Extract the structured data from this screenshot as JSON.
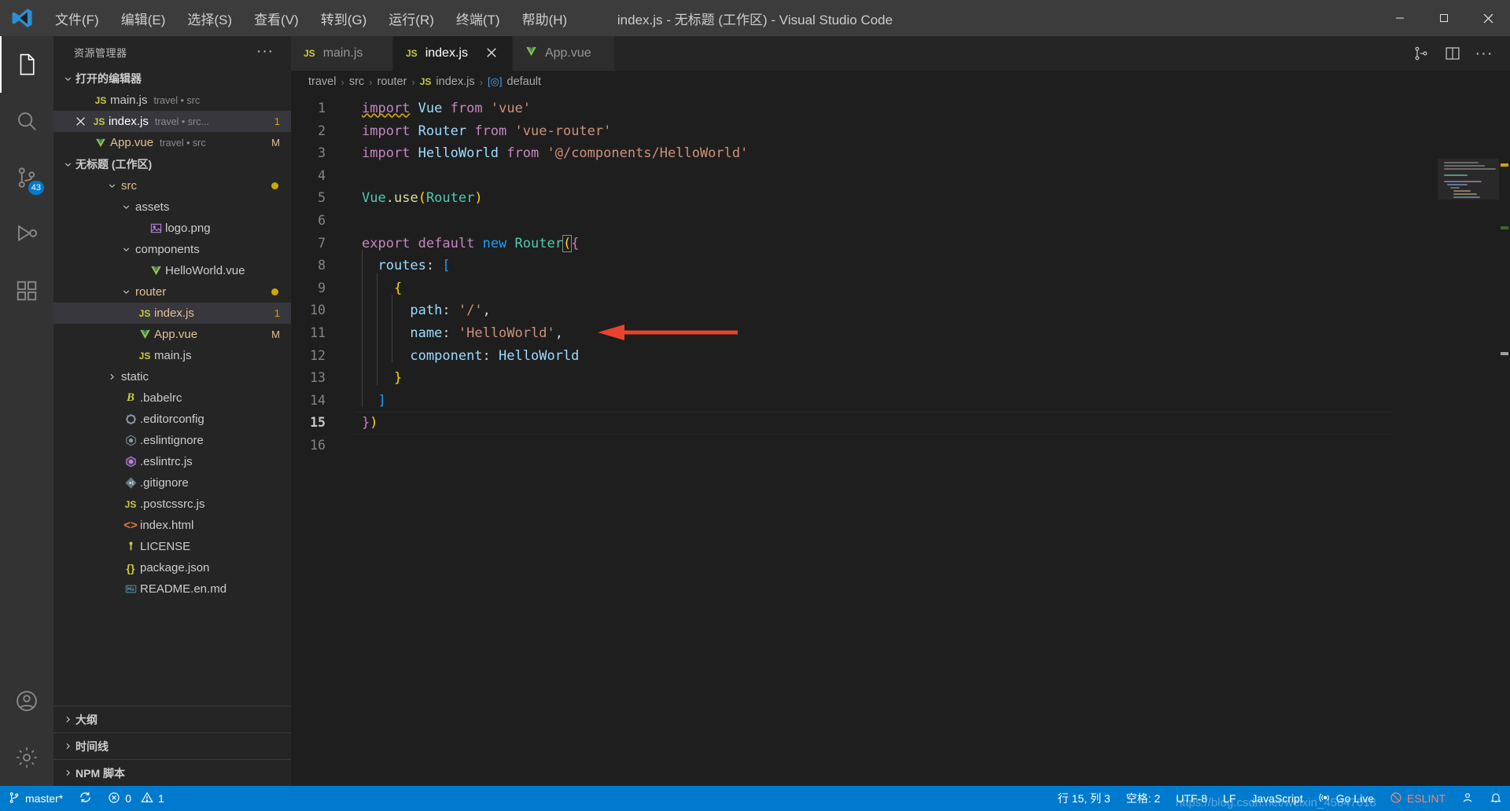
{
  "window": {
    "title": "index.js - 无标题 (工作区) - Visual Studio Code",
    "minimize": "−",
    "maximize": "□",
    "close": "✕"
  },
  "menu": [
    {
      "label": "文件(F)"
    },
    {
      "label": "编辑(E)"
    },
    {
      "label": "选择(S)"
    },
    {
      "label": "查看(V)"
    },
    {
      "label": "转到(G)"
    },
    {
      "label": "运行(R)"
    },
    {
      "label": "终端(T)"
    },
    {
      "label": "帮助(H)"
    }
  ],
  "activitybar": [
    {
      "name": "explorer",
      "icon": "files-icon",
      "active": true,
      "badge": ""
    },
    {
      "name": "search",
      "icon": "search-icon",
      "active": false,
      "badge": ""
    },
    {
      "name": "source-control",
      "icon": "source-control-icon",
      "active": false,
      "badge": "43"
    },
    {
      "name": "run-debug",
      "icon": "run-debug-icon",
      "active": false,
      "badge": ""
    },
    {
      "name": "extensions",
      "icon": "extensions-icon",
      "active": false,
      "badge": ""
    },
    {
      "name": "accounts",
      "icon": "account-icon",
      "active": false,
      "badge": ""
    },
    {
      "name": "settings",
      "icon": "gear-icon",
      "active": false,
      "badge": ""
    }
  ],
  "sidebar": {
    "header": "资源管理器",
    "more": "···",
    "open_editors": {
      "title": "打开的编辑器",
      "items": [
        {
          "name": "main.js",
          "desc": "travel • src",
          "icon": "js-icon",
          "badge": "",
          "selected": false,
          "close": false,
          "color": "#cccccc"
        },
        {
          "name": "index.js",
          "desc": "travel • src...",
          "icon": "js-icon",
          "badge": "1",
          "selected": true,
          "close": true,
          "color": "#e2c08d"
        },
        {
          "name": "App.vue",
          "desc": "travel • src",
          "icon": "vue-icon",
          "badge": "M",
          "selected": false,
          "close": false,
          "color": "#e2c08d"
        }
      ]
    },
    "workspace": {
      "title": "无标题 (工作区)",
      "items": [
        {
          "name": "src",
          "indent": 1,
          "type": "folder",
          "expanded": true,
          "icon": "chevron-down-icon",
          "color": "#e2c08d",
          "badge": "",
          "dot": true
        },
        {
          "name": "assets",
          "indent": 2,
          "type": "folder",
          "expanded": true,
          "icon": "chevron-down-icon",
          "color": "#cccccc",
          "badge": "",
          "dot": false
        },
        {
          "name": "logo.png",
          "indent": 3,
          "type": "file",
          "icon": "image-icon",
          "color": "#cccccc",
          "badge": "",
          "dot": false
        },
        {
          "name": "components",
          "indent": 2,
          "type": "folder",
          "expanded": true,
          "icon": "chevron-down-icon",
          "color": "#cccccc",
          "badge": "",
          "dot": false
        },
        {
          "name": "HelloWorld.vue",
          "indent": 3,
          "type": "file",
          "icon": "vue-icon",
          "color": "#cccccc",
          "badge": "",
          "dot": false
        },
        {
          "name": "router",
          "indent": 2,
          "type": "folder",
          "expanded": true,
          "icon": "chevron-down-icon",
          "color": "#e2c08d",
          "badge": "",
          "dot": true
        },
        {
          "name": "index.js",
          "indent": 3,
          "type": "file",
          "icon": "js-icon",
          "color": "#e2c08d",
          "badge": "1",
          "dot": false,
          "selected": true
        },
        {
          "name": "App.vue",
          "indent": 2,
          "type": "file",
          "icon": "vue-icon",
          "color": "#e2c08d",
          "badge": "M",
          "dot": false
        },
        {
          "name": "main.js",
          "indent": 2,
          "type": "file",
          "icon": "js-icon",
          "color": "#cccccc",
          "badge": "",
          "dot": false
        },
        {
          "name": "static",
          "indent": 1,
          "type": "folder",
          "expanded": false,
          "icon": "chevron-right-icon",
          "color": "#cccccc",
          "badge": "",
          "dot": false
        },
        {
          "name": ".babelrc",
          "indent": 1,
          "type": "file",
          "icon": "babel-icon",
          "color": "#cccccc",
          "badge": "",
          "dot": false
        },
        {
          "name": ".editorconfig",
          "indent": 1,
          "type": "file",
          "icon": "gear-file-icon",
          "color": "#cccccc",
          "badge": "",
          "dot": false
        },
        {
          "name": ".eslintignore",
          "indent": 1,
          "type": "file",
          "icon": "eslint-gray-icon",
          "color": "#cccccc",
          "badge": "",
          "dot": false
        },
        {
          "name": ".eslintrc.js",
          "indent": 1,
          "type": "file",
          "icon": "eslint-icon",
          "color": "#cccccc",
          "badge": "",
          "dot": false
        },
        {
          "name": ".gitignore",
          "indent": 1,
          "type": "file",
          "icon": "git-icon",
          "color": "#cccccc",
          "badge": "",
          "dot": false
        },
        {
          "name": ".postcssrc.js",
          "indent": 1,
          "type": "file",
          "icon": "js-icon",
          "color": "#cccccc",
          "badge": "",
          "dot": false
        },
        {
          "name": "index.html",
          "indent": 1,
          "type": "file",
          "icon": "html-icon",
          "color": "#cccccc",
          "badge": "",
          "dot": false
        },
        {
          "name": "LICENSE",
          "indent": 1,
          "type": "file",
          "icon": "license-icon",
          "color": "#cccccc",
          "badge": "",
          "dot": false
        },
        {
          "name": "package.json",
          "indent": 1,
          "type": "file",
          "icon": "json-icon",
          "color": "#cccccc",
          "badge": "",
          "dot": false
        },
        {
          "name": "README.en.md",
          "indent": 1,
          "type": "file",
          "icon": "md-icon",
          "color": "#cccccc",
          "badge": "",
          "dot": false
        }
      ]
    },
    "bottom_sections": [
      {
        "label": "大纲"
      },
      {
        "label": "时间线"
      },
      {
        "label": "NPM 脚本"
      }
    ]
  },
  "tabs": [
    {
      "label": "main.js",
      "icon": "js-icon",
      "active": false,
      "close": false
    },
    {
      "label": "index.js",
      "icon": "js-icon",
      "active": true,
      "close": true
    },
    {
      "label": "App.vue",
      "icon": "vue-icon",
      "active": false,
      "close": false
    }
  ],
  "tab_actions": [
    {
      "name": "split-compare-icon",
      "label": "⧉"
    },
    {
      "name": "split-editor-icon",
      "label": "▥"
    },
    {
      "name": "more-actions-icon",
      "label": "···"
    }
  ],
  "breadcrumb": [
    {
      "label": "travel",
      "icon": ""
    },
    {
      "label": "src",
      "icon": ""
    },
    {
      "label": "router",
      "icon": ""
    },
    {
      "label": "index.js",
      "icon": "js-icon"
    },
    {
      "label": "default",
      "icon": "symbol-icon"
    }
  ],
  "editor": {
    "language": "JavaScript",
    "current_line": 15,
    "lines": [
      {
        "n": 1,
        "text": "import Vue from 'vue'"
      },
      {
        "n": 2,
        "text": "import Router from 'vue-router'"
      },
      {
        "n": 3,
        "text": "import HelloWorld from '@/components/HelloWorld'"
      },
      {
        "n": 4,
        "text": ""
      },
      {
        "n": 5,
        "text": "Vue.use(Router)"
      },
      {
        "n": 6,
        "text": ""
      },
      {
        "n": 7,
        "text": "export default new Router({"
      },
      {
        "n": 8,
        "text": "  routes: ["
      },
      {
        "n": 9,
        "text": "    {"
      },
      {
        "n": 10,
        "text": "      path: '/',"
      },
      {
        "n": 11,
        "text": "      name: 'HelloWorld',"
      },
      {
        "n": 12,
        "text": "      component: HelloWorld"
      },
      {
        "n": 13,
        "text": "    }"
      },
      {
        "n": 14,
        "text": "  ]"
      },
      {
        "n": 15,
        "text": "})"
      },
      {
        "n": 16,
        "text": ""
      }
    ]
  },
  "statusbar": {
    "left": [
      {
        "name": "remote-branch",
        "icon": "branch-icon",
        "label": "master*"
      },
      {
        "name": "sync-changes",
        "icon": "sync-icon",
        "label": ""
      },
      {
        "name": "problems",
        "icon": "error-warning-icon",
        "errors": "0",
        "warnings": "1"
      }
    ],
    "right": [
      {
        "name": "cursor-position",
        "label": "行 15, 列 3"
      },
      {
        "name": "indentation",
        "label": "空格: 2"
      },
      {
        "name": "encoding",
        "label": "UTF-8"
      },
      {
        "name": "eol",
        "label": "LF"
      },
      {
        "name": "language-mode",
        "label": "JavaScript"
      },
      {
        "name": "go-live",
        "label": "Go Live",
        "icon": "broadcast-icon"
      },
      {
        "name": "eslint",
        "label": "ESLINT",
        "icon": "eslint-status-icon"
      },
      {
        "name": "account",
        "label": "",
        "icon": "account-icon"
      },
      {
        "name": "notifications",
        "label": "",
        "icon": "bell-icon"
      }
    ],
    "watermark": "https://blog.csdn.net/weixin_45647018"
  },
  "colors": {
    "accent": "#007acc",
    "titlebar": "#3c3c3c",
    "sidebar": "#252526",
    "editor": "#1e1e1e",
    "activitybar": "#333333",
    "modified": "#e2c08d",
    "warning": "#cca700",
    "arrow": "#e8432e"
  }
}
